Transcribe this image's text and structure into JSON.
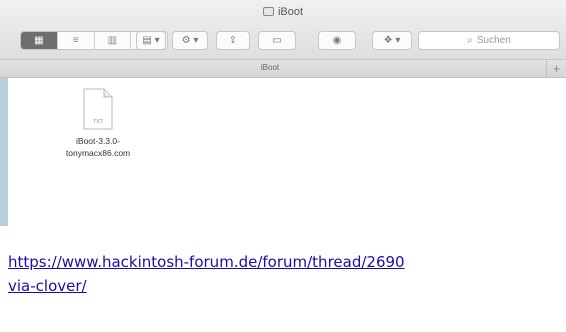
{
  "window": {
    "title": "iBoot"
  },
  "toolbar": {
    "view_icon": "view-icons-icon",
    "view_list": "view-list-icon",
    "view_columns": "view-columns-icon",
    "view_coverflow": "view-coverflow-icon",
    "arrange_icon": "arrange-icon",
    "action_icon": "gear-icon",
    "share_icon": "share-icon",
    "tags_icon": "tag-icon",
    "quicklook_icon": "eye-icon",
    "dropbox_icon": "dropbox-icon",
    "search_placeholder": "Suchen"
  },
  "tabbar": {
    "label": "iBoot",
    "add_label": "+"
  },
  "files": [
    {
      "name_line1": "iBoot-3.3.0-",
      "name_line2": "tonymacx86.com",
      "icon_text": "TXT"
    }
  ],
  "link": {
    "line1": "https://www.hackintosh-forum.de/forum/thread/2690",
    "line2": "via-clover/"
  },
  "colors": {
    "link": "#1a0dab",
    "sidebar": "#b9cfe1"
  }
}
